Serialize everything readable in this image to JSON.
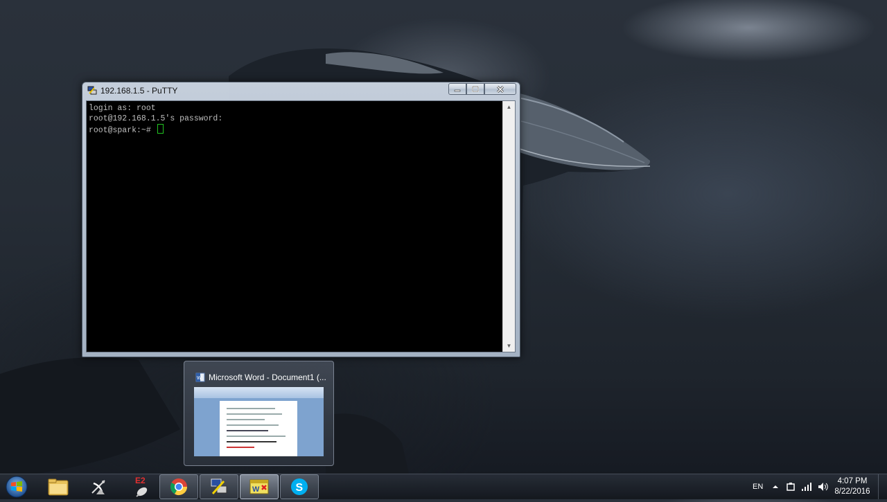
{
  "putty": {
    "title": "192.168.1.5 - PuTTY",
    "lines": [
      "login as: root",
      "root@192.168.1.5's password:",
      "root@spark:~# "
    ],
    "icon": "putty-icon"
  },
  "preview": {
    "title": "Microsoft Word - Document1 (...",
    "icon": "word-icon"
  },
  "taskbar": {
    "items": [
      {
        "name": "windows-explorer",
        "icon": "folder-icon"
      },
      {
        "name": "satellite-app",
        "icon": "satellite-icon"
      },
      {
        "name": "e2-app",
        "icon": "e2-icon",
        "label": "E2"
      },
      {
        "name": "chrome",
        "icon": "chrome-icon"
      },
      {
        "name": "putty",
        "icon": "putty-icon"
      },
      {
        "name": "word",
        "icon": "word-icon"
      },
      {
        "name": "skype",
        "icon": "skype-icon"
      }
    ],
    "language": "EN",
    "time": "4:07 PM",
    "date": "8/22/2016"
  }
}
